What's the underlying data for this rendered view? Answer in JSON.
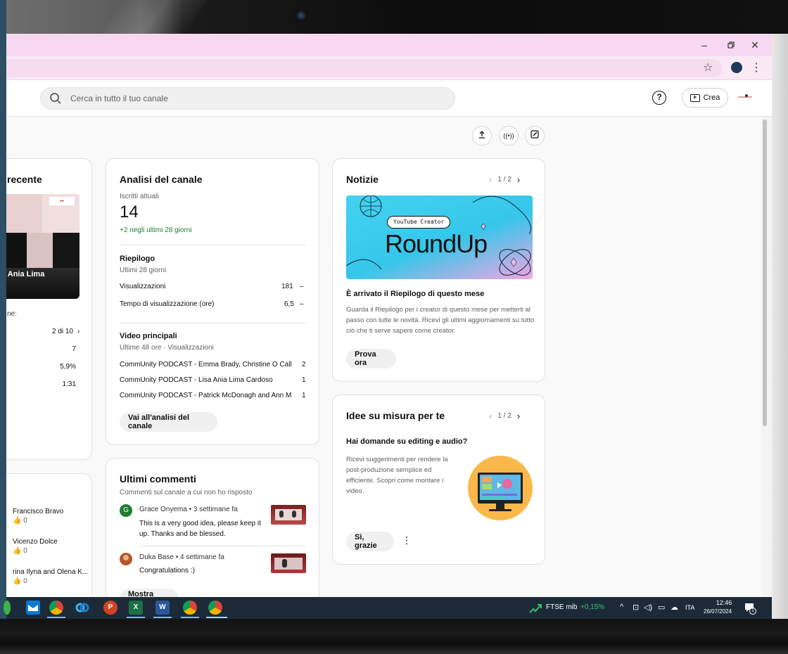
{
  "search": {
    "placeholder": "Cerca in tutto il tuo canale"
  },
  "header": {
    "create_label": "Crea"
  },
  "recent_video": {
    "title_partial": "recente",
    "thumbnail_text": "a Ania Lima",
    "caption_partial": "ne:",
    "rank": "2 di 10",
    "stats": [
      "7",
      "5,9%",
      "1:31"
    ]
  },
  "recent_list": {
    "items": [
      {
        "name": "Francisco Bravo",
        "likes": "0"
      },
      {
        "name": "Vicenzo Dolce",
        "likes": "0"
      },
      {
        "name": "rina Ilyna and Olena K...",
        "likes": "0"
      }
    ]
  },
  "analytics": {
    "title": "Analisi del canale",
    "subs_label": "Iscritti attuali",
    "subs_value": "14",
    "subs_delta": "+2 negli ultimi 28 giorni",
    "summary_title": "Riepilogo",
    "summary_sub": "Ultimi 28 giorni",
    "metrics": [
      {
        "label": "Visualizzazioni",
        "value": "181",
        "trend": "–"
      },
      {
        "label": "Tempo di visualizzazione (ore)",
        "value": "6,5",
        "trend": "–"
      }
    ],
    "top_title": "Video principali",
    "top_sub": "Ultime 48 ore · Visualizzazioni",
    "top_videos": [
      {
        "title": "CommUnity PODCAST - Emma Brady, Christine O Calla...",
        "views": "2"
      },
      {
        "title": "CommUnity PODCAST - Lisa Ania Lima Cardoso",
        "views": "1"
      },
      {
        "title": "CommUnity PODCAST - Patrick McDonagh and Ann Ma...",
        "views": "1"
      }
    ],
    "button": "Vai all'analisi del canale"
  },
  "comments": {
    "title": "Ultimi commenti",
    "subtitle": "Commenti sul canale a cui non ho risposto",
    "items": [
      {
        "initial": "G",
        "author": "Grace Onyema",
        "time": "3 settimane fa",
        "text": "This is a very good  idea, please keep it up. Thanks and be blessed.",
        "avatar_color": "#1e7d32"
      },
      {
        "initial": "",
        "author": "Duka Base",
        "time": "4 settimane fa",
        "text": "Congratulations :)",
        "avatar_color": "#b5562c"
      }
    ],
    "more_button": "Mostra altro"
  },
  "news": {
    "title": "Notizie",
    "pager": "1 / 2",
    "banner_tag": "YouTube Creator",
    "banner_title": "RoundUp",
    "headline": "È arrivato il Riepilogo di questo mese",
    "body": "Guarda il Riepilogo per i creator di questo mese per metterti al passo con tutte le novità. Ricevi gli ultimi aggiornamenti su tutto ciò che ti serve sapere come creator.",
    "button": "Prova ora"
  },
  "ideas": {
    "title": "Idee su misura per te",
    "pager": "1 / 2",
    "headline": "Hai domande su editing e audio?",
    "body": "Ricevi suggerimenti per rendere la post-produzione semplice ed efficiente. Scopri come montare i video.",
    "button": "Sì, grazie"
  },
  "taskbar": {
    "ticker_name": "FTSE mib",
    "ticker_value": "+0,15%",
    "lang": "ITA",
    "time": "12:46",
    "date": "26/07/2024",
    "notif_count": "1"
  },
  "colors": {
    "ticker_positive": "#37c26a",
    "accent_green": "#1e7d32",
    "banner_cyan": "#3fd0ec",
    "banner_pink": "#f7a8e4"
  }
}
